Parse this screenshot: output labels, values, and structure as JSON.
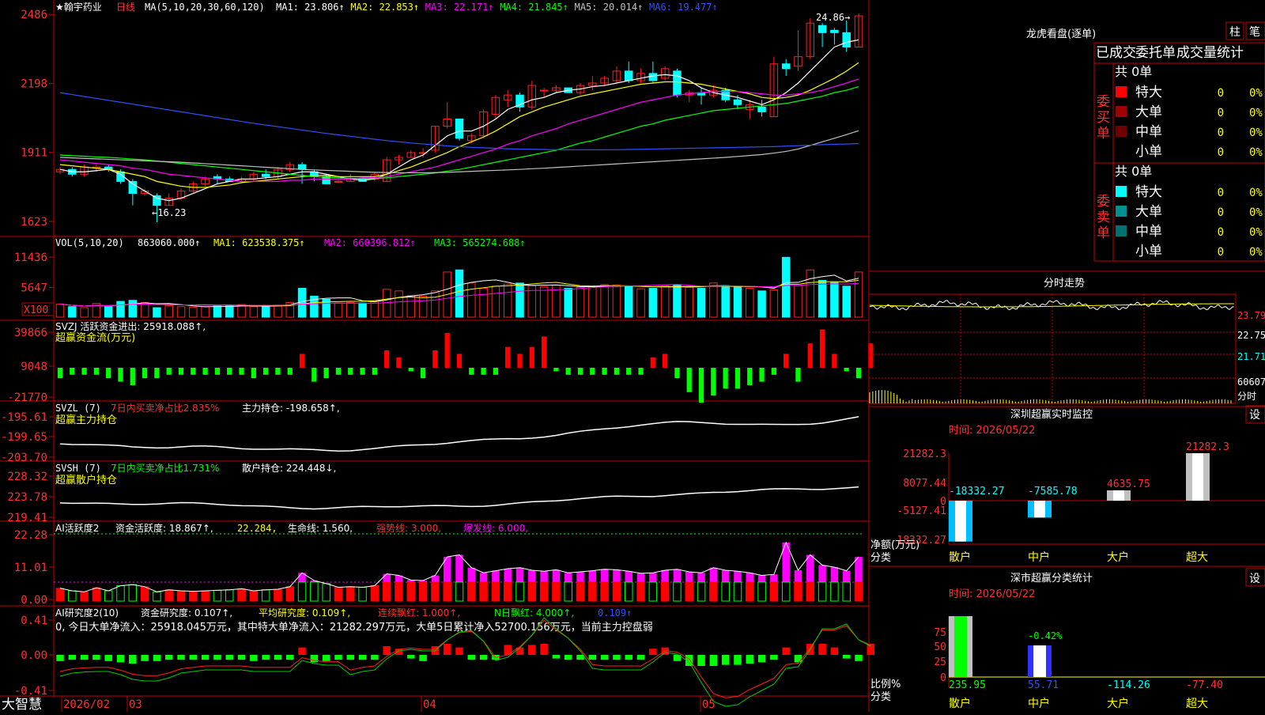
{
  "app": {
    "brand": "大智慧",
    "period_tag": "日线",
    "stock_name": "★翰宇药业"
  },
  "colors": {
    "up": "#ff2020",
    "down": "#00ffff",
    "ma1": "#ffffff",
    "ma2": "#ffff00",
    "ma3": "#ff00ff",
    "ma4": "#00ff00",
    "ma5": "#c0c0c0",
    "ma6": "#3050ff",
    "frame": "#c00000"
  },
  "price_panel": {
    "ma_label": "MA(5,10,20,30,60,120)",
    "ma_values": [
      {
        "name": "MA1",
        "value": "23.806↑",
        "color": "#ffffff"
      },
      {
        "name": "MA2",
        "value": "22.853↑",
        "color": "#ffff00"
      },
      {
        "name": "MA3",
        "value": "22.171↑",
        "color": "#ff00ff"
      },
      {
        "name": "MA4",
        "value": "21.845↑",
        "color": "#00ff00"
      },
      {
        "name": "MA5",
        "value": "20.014↑",
        "color": "#c0c0c0"
      },
      {
        "name": "MA6",
        "value": "19.477↑",
        "color": "#3050ff"
      }
    ],
    "y_ticks": [
      "2486",
      "2198",
      "1911",
      "1623"
    ],
    "high_mark": "24.86→",
    "low_mark": "←16.23"
  },
  "vol_panel": {
    "label": "VOL(5,10,20)",
    "value": "863060.000↑",
    "ma1": "MA1: 623538.375↑",
    "ma2": "MA2: 660396.812↑",
    "ma3": "MA3: 565274.688↑",
    "y_ticks": [
      "11436",
      "5647"
    ],
    "unit": "X100"
  },
  "svzj_panel": {
    "label": "SVZJ  活跃资金进出: 25918.088↑,",
    "subtitle": "超赢资金流(万元)",
    "y_ticks": [
      "39866",
      "9048",
      "-21770"
    ]
  },
  "svzl_panel": {
    "label": "SVZL (7)",
    "pct": "7日内买卖净占比2.835%",
    "value": "主力持仓: -198.658↑,",
    "subtitle": "超赢主力持仓",
    "y_ticks": [
      "-195.61",
      "-199.65",
      "-203.70"
    ]
  },
  "svsh_panel": {
    "label": "SVSH (7)",
    "pct": "7日内买卖净占比1.731%",
    "value": "散户持仓: 224.448↓,",
    "subtitle": "超赢散户持仓",
    "y_ticks": [
      "228.32",
      "223.78",
      "219.41"
    ]
  },
  "ai1_panel": {
    "label": "AI活跃度2",
    "v1": "资金活跃度: 18.867↑,",
    "v2": "22.284,",
    "v3": "生命线: 1.560,",
    "v4": "强势线: 3.000,",
    "v5": "爆发线: 6.000,",
    "y_ticks": [
      "22.28",
      "11.01",
      "0.00"
    ]
  },
  "ai2_panel": {
    "label": "AI研究度2(10)",
    "v1": "资金研究度: 0.107↑,",
    "v2": "平均研究度: 0.109↑,",
    "v3": "连续飘红: 1.000↑,",
    "v4": "N日飘红: 4.000↑,",
    "v5": "0.109↑",
    "note": "0, 今日大单净流入：25918.045万元，其中特大单净流入：21282.297万元，大单5日累计净入52700.156万元，当前主力控盘弱",
    "y_ticks": [
      "0.41",
      "0.00",
      "-0.41"
    ]
  },
  "xaxis": {
    "labels": [
      "2026/02",
      "03",
      "04",
      "05"
    ]
  },
  "dragon": {
    "title": "龙虎看盘(逐单)",
    "btn1": "柱",
    "btn2": "笔",
    "tabs": [
      "已成交",
      "委托单",
      "成交量统计"
    ],
    "buy_side": {
      "title": "委买单",
      "total": "共 0单",
      "rows": [
        {
          "label": "特大",
          "n": "0",
          "p": "0%",
          "color": "#ff0000"
        },
        {
          "label": "大单",
          "n": "0",
          "p": "0%",
          "color": "#a00000"
        },
        {
          "label": "中单",
          "n": "0",
          "p": "0%",
          "color": "#700000"
        },
        {
          "label": "小单",
          "n": "0",
          "p": "0%",
          "color": ""
        }
      ]
    },
    "sell_side": {
      "title": "委卖单",
      "total": "共 0单",
      "rows": [
        {
          "label": "特大",
          "n": "0",
          "p": "0%",
          "color": "#00ffff"
        },
        {
          "label": "大单",
          "n": "0",
          "p": "0%",
          "color": "#009090"
        },
        {
          "label": "中单",
          "n": "0",
          "p": "0%",
          "color": "#007070"
        },
        {
          "label": "小单",
          "n": "0",
          "p": "0%",
          "color": ""
        }
      ]
    }
  },
  "intraday": {
    "title": "分时走势",
    "right_ticks": [
      "23.79",
      "22.75",
      "21.71",
      "60607"
    ],
    "right_unit": "分时"
  },
  "monitor": {
    "title": "深圳超赢实时监控",
    "btn": "设",
    "time": "时间: 2026/05/22",
    "y_ticks": [
      "21282.3",
      "8077.44",
      "0",
      "-5127.41",
      "-18332.27"
    ],
    "y_label": "净额(万元)",
    "cat_label": "分类",
    "categories": [
      "散户",
      "中户",
      "大户",
      "超大"
    ],
    "values": [
      -18332.27,
      -7585.78,
      4635.75,
      21282.3
    ],
    "value_labels": [
      "-18332.27",
      "-7585.78",
      "4635.75",
      "21282.3"
    ]
  },
  "classify": {
    "title": "深市超赢分类统计",
    "btn": "设",
    "time": "时间: 2026/05/22",
    "y_ticks": [
      "75",
      "50",
      "25",
      "0"
    ],
    "y_label": "比例%",
    "cat_label": "分类",
    "categories": [
      "散户",
      "中户",
      "大户",
      "超大"
    ],
    "values": [
      235.95,
      55.71,
      -114.26,
      -77.4
    ],
    "value_labels": [
      "235.95",
      "55.71",
      "-114.26",
      "-77.40"
    ],
    "pct_label": "-0.42%"
  },
  "chart_data": {
    "type": "candlestick",
    "title": "翰宇药业 日线",
    "candles": [
      [
        18.3,
        18.4,
        18.2,
        18.5
      ],
      [
        18.4,
        18.2,
        18.1,
        18.5
      ],
      [
        18.2,
        18.5,
        18.1,
        18.6
      ],
      [
        18.5,
        18.5,
        18.3,
        18.6
      ],
      [
        18.5,
        18.4,
        18.3,
        18.6
      ],
      [
        18.3,
        17.9,
        17.8,
        18.4
      ],
      [
        17.9,
        17.4,
        16.9,
        18.0
      ],
      [
        17.4,
        17.5,
        17.3,
        17.6
      ],
      [
        17.3,
        16.9,
        16.2,
        17.4
      ],
      [
        16.9,
        17.2,
        16.9,
        17.4
      ],
      [
        17.2,
        17.5,
        17.1,
        17.6
      ],
      [
        17.5,
        17.8,
        17.4,
        17.9
      ],
      [
        17.8,
        18.0,
        17.7,
        18.1
      ],
      [
        18.1,
        18.0,
        17.8,
        18.2
      ],
      [
        18.0,
        17.9,
        17.9,
        18.1
      ],
      [
        17.9,
        18.0,
        17.8,
        18.1
      ],
      [
        18.0,
        18.2,
        17.9,
        18.3
      ],
      [
        18.2,
        18.1,
        18.0,
        18.4
      ],
      [
        18.1,
        18.4,
        18.0,
        18.5
      ],
      [
        18.4,
        18.6,
        18.3,
        18.7
      ],
      [
        18.6,
        18.4,
        17.8,
        18.7
      ],
      [
        18.3,
        18.1,
        17.9,
        18.4
      ],
      [
        18.1,
        17.8,
        17.8,
        18.2
      ],
      [
        17.9,
        17.9,
        17.9,
        18.0
      ],
      [
        17.9,
        18.0,
        17.9,
        18.2
      ],
      [
        18.0,
        17.9,
        17.9,
        18.0
      ],
      [
        18.0,
        18.2,
        17.9,
        18.3
      ],
      [
        17.9,
        18.8,
        17.9,
        18.9
      ],
      [
        18.8,
        18.9,
        18.6,
        19.0
      ],
      [
        18.9,
        19.1,
        18.9,
        19.2
      ],
      [
        19.1,
        19.1,
        18.9,
        19.3
      ],
      [
        19.2,
        20.2,
        19.1,
        20.2
      ],
      [
        20.2,
        20.5,
        20.1,
        21.2
      ],
      [
        20.5,
        19.7,
        19.6,
        20.5
      ],
      [
        19.6,
        19.8,
        19.5,
        19.9
      ],
      [
        19.8,
        20.8,
        19.7,
        20.9
      ],
      [
        20.7,
        21.4,
        20.5,
        21.5
      ],
      [
        21.3,
        21.5,
        21.0,
        21.7
      ],
      [
        21.5,
        21.0,
        20.8,
        21.6
      ],
      [
        21.0,
        21.9,
        20.9,
        22.1
      ],
      [
        21.7,
        21.7,
        21.4,
        21.8
      ],
      [
        21.7,
        21.8,
        21.6,
        21.9
      ],
      [
        21.8,
        21.6,
        21.6,
        21.8
      ],
      [
        21.6,
        21.9,
        21.5,
        22.0
      ],
      [
        21.9,
        22.0,
        21.7,
        22.3
      ],
      [
        22.0,
        22.2,
        21.9,
        22.3
      ],
      [
        22.1,
        22.5,
        22.0,
        22.7
      ],
      [
        22.5,
        22.1,
        22.0,
        22.9
      ],
      [
        22.1,
        22.4,
        22.0,
        22.6
      ],
      [
        22.4,
        22.1,
        22.0,
        22.9
      ],
      [
        22.2,
        22.6,
        22.1,
        22.7
      ],
      [
        22.5,
        21.5,
        21.4,
        22.6
      ],
      [
        21.5,
        21.6,
        21.2,
        21.7
      ],
      [
        21.6,
        21.5,
        21.1,
        21.8
      ],
      [
        21.5,
        21.7,
        21.4,
        21.9
      ],
      [
        21.7,
        21.3,
        21.2,
        21.8
      ],
      [
        21.3,
        21.1,
        20.9,
        21.5
      ],
      [
        20.9,
        21.1,
        20.5,
        21.3
      ],
      [
        21.0,
        20.8,
        20.6,
        21.3
      ],
      [
        20.6,
        22.8,
        20.6,
        23.1
      ],
      [
        22.8,
        22.6,
        22.3,
        23.0
      ],
      [
        22.7,
        23.1,
        22.5,
        24.2
      ],
      [
        23.1,
        24.5,
        23.0,
        24.7
      ],
      [
        24.4,
        24.1,
        23.5,
        24.5
      ],
      [
        24.2,
        24.1,
        23.6,
        24.3
      ],
      [
        24.1,
        23.5,
        23.3,
        24.6
      ],
      [
        23.5,
        24.8,
        23.5,
        24.9
      ]
    ],
    "ma_series": [
      {
        "name": "MA1",
        "color": "#ffffff",
        "values": [
          18.4,
          18.3,
          18.3,
          18.35,
          18.4,
          18.2,
          17.8,
          17.5,
          17.2,
          17.1,
          17.2,
          17.4,
          17.6,
          17.8,
          17.9,
          18.0,
          18.0,
          18.05,
          18.1,
          18.2,
          18.3,
          18.3,
          18.2,
          18.1,
          18.0,
          17.95,
          18.0,
          18.2,
          18.5,
          18.8,
          19.0,
          19.4,
          19.8,
          20.0,
          20.0,
          20.2,
          20.5,
          20.9,
          21.1,
          21.3,
          21.4,
          21.6,
          21.7,
          21.75,
          21.85,
          21.9,
          22.0,
          22.1,
          22.2,
          22.3,
          22.35,
          22.3,
          22.1,
          21.8,
          21.6,
          21.5,
          21.4,
          21.25,
          21.1,
          21.3,
          21.6,
          22.0,
          22.5,
          23.0,
          23.5,
          23.7,
          23.8
        ]
      },
      {
        "name": "MA2",
        "color": "#ffff00",
        "values": [
          18.6,
          18.55,
          18.5,
          18.45,
          18.4,
          18.3,
          18.2,
          18.1,
          17.9,
          17.8,
          17.7,
          17.65,
          17.65,
          17.7,
          17.75,
          17.85,
          17.9,
          17.95,
          18.0,
          18.05,
          18.1,
          18.15,
          18.15,
          18.1,
          18.1,
          18.1,
          18.1,
          18.2,
          18.35,
          18.5,
          18.7,
          18.9,
          19.1,
          19.35,
          19.55,
          19.75,
          20.0,
          20.3,
          20.6,
          20.8,
          21.0,
          21.15,
          21.3,
          21.45,
          21.55,
          21.65,
          21.75,
          21.85,
          21.95,
          22.0,
          22.05,
          22.05,
          22.0,
          21.95,
          21.85,
          21.75,
          21.65,
          21.55,
          21.4,
          21.35,
          21.4,
          21.5,
          21.7,
          21.95,
          22.2,
          22.5,
          22.85
        ]
      },
      {
        "name": "MA3",
        "color": "#ff00ff",
        "values": [
          18.8,
          18.75,
          18.7,
          18.65,
          18.6,
          18.55,
          18.45,
          18.4,
          18.3,
          18.2,
          18.15,
          18.1,
          18.05,
          18.0,
          17.95,
          17.9,
          17.9,
          17.9,
          17.9,
          17.95,
          17.95,
          18.0,
          18.0,
          18.0,
          18.0,
          18.05,
          18.05,
          18.1,
          18.2,
          18.3,
          18.4,
          18.5,
          18.65,
          18.8,
          18.95,
          19.1,
          19.25,
          19.45,
          19.6,
          19.8,
          19.95,
          20.1,
          20.3,
          20.45,
          20.6,
          20.75,
          20.9,
          21.05,
          21.2,
          21.3,
          21.4,
          21.5,
          21.55,
          21.6,
          21.65,
          21.65,
          21.65,
          21.6,
          21.55,
          21.5,
          21.5,
          21.55,
          21.6,
          21.7,
          21.85,
          22.0,
          22.17
        ]
      },
      {
        "name": "MA4",
        "color": "#00ff00",
        "values": [
          19.0,
          18.97,
          18.95,
          18.92,
          18.9,
          18.87,
          18.83,
          18.8,
          18.75,
          18.7,
          18.65,
          18.6,
          18.55,
          18.5,
          18.45,
          18.4,
          18.35,
          18.3,
          18.25,
          18.2,
          18.15,
          18.1,
          18.07,
          18.05,
          18.03,
          18.02,
          18.02,
          18.05,
          18.1,
          18.15,
          18.2,
          18.25,
          18.33,
          18.4,
          18.5,
          18.6,
          18.7,
          18.8,
          18.9,
          19.0,
          19.1,
          19.2,
          19.35,
          19.5,
          19.6,
          19.75,
          19.9,
          20.05,
          20.2,
          20.3,
          20.45,
          20.55,
          20.65,
          20.75,
          20.85,
          20.9,
          20.95,
          21.0,
          21.05,
          21.1,
          21.15,
          21.25,
          21.35,
          21.45,
          21.6,
          21.7,
          21.85
        ]
      },
      {
        "name": "MA5",
        "color": "#c0c0c0",
        "values": [
          18.9,
          18.88,
          18.86,
          18.84,
          18.82,
          18.8,
          18.78,
          18.76,
          18.74,
          18.72,
          18.7,
          18.67,
          18.64,
          18.61,
          18.58,
          18.55,
          18.52,
          18.49,
          18.46,
          18.43,
          18.4,
          18.38,
          18.36,
          18.34,
          18.32,
          18.3,
          18.28,
          18.27,
          18.26,
          18.26,
          18.26,
          18.27,
          18.28,
          18.3,
          18.32,
          18.34,
          18.36,
          18.38,
          18.4,
          18.43,
          18.45,
          18.48,
          18.51,
          18.54,
          18.57,
          18.6,
          18.63,
          18.66,
          18.69,
          18.72,
          18.75,
          18.78,
          18.81,
          18.84,
          18.87,
          18.9,
          18.94,
          18.98,
          19.02,
          19.08,
          19.15,
          19.25,
          19.4,
          19.55,
          19.7,
          19.85,
          20.01
        ]
      },
      {
        "name": "MA6",
        "color": "#3050ff",
        "values": [
          21.6,
          21.52,
          21.44,
          21.36,
          21.28,
          21.2,
          21.12,
          21.04,
          20.96,
          20.88,
          20.8,
          20.72,
          20.64,
          20.56,
          20.48,
          20.4,
          20.32,
          20.25,
          20.18,
          20.11,
          20.04,
          19.97,
          19.9,
          19.84,
          19.78,
          19.72,
          19.66,
          19.6,
          19.55,
          19.5,
          19.46,
          19.42,
          19.38,
          19.35,
          19.32,
          19.3,
          19.28,
          19.26,
          19.25,
          19.24,
          19.23,
          19.22,
          19.22,
          19.22,
          19.22,
          19.22,
          19.22,
          19.23,
          19.24,
          19.25,
          19.26,
          19.27,
          19.28,
          19.29,
          19.3,
          19.31,
          19.32,
          19.33,
          19.34,
          19.35,
          19.37,
          19.39,
          19.41,
          19.43,
          19.45,
          19.46,
          19.477
        ]
      }
    ],
    "volume": [
      2.5,
      2.0,
      1.8,
      2.6,
      2.0,
      3.0,
      3.2,
      2.8,
      1.8,
      2.2,
      2.0,
      1.9,
      2.0,
      2.1,
      2.2,
      2.4,
      2.0,
      2.2,
      2.3,
      2.8,
      5.5,
      4.0,
      3.4,
      2.7,
      2.8,
      2.7,
      3.0,
      5.3,
      5.0,
      4.1,
      4.0,
      5.0,
      8.6,
      9.0,
      6.5,
      5.5,
      5.9,
      6.3,
      6.5,
      6.0,
      5.8,
      6.1,
      5.5,
      5.7,
      5.9,
      6.2,
      6.1,
      5.8,
      5.4,
      5.5,
      6.0,
      6.2,
      5.7,
      5.5,
      6.5,
      6.0,
      5.8,
      5.5,
      5.0,
      5.2,
      11.4,
      6.0,
      9.0,
      7.0,
      6.6,
      5.9,
      8.6
    ],
    "svzj": [
      -3,
      -2,
      -2,
      -2,
      -3,
      -4,
      -5,
      -3,
      -3,
      -2,
      -2,
      -2,
      -2,
      -2,
      -2,
      -2,
      -3,
      -2,
      -2,
      -2,
      4,
      -4,
      -3,
      -2,
      -2,
      -2,
      -2,
      5,
      3,
      -1,
      -3,
      5,
      10,
      4,
      -2,
      -2,
      -2,
      6,
      4,
      6,
      9,
      -1,
      -2,
      -2,
      -2,
      -2,
      -2,
      -2,
      -2,
      3,
      4,
      -3,
      -7,
      -10,
      -8,
      -6,
      -6,
      -5,
      -4,
      -2,
      4,
      -4,
      7,
      11,
      4,
      -1,
      -3,
      7
    ]
  }
}
